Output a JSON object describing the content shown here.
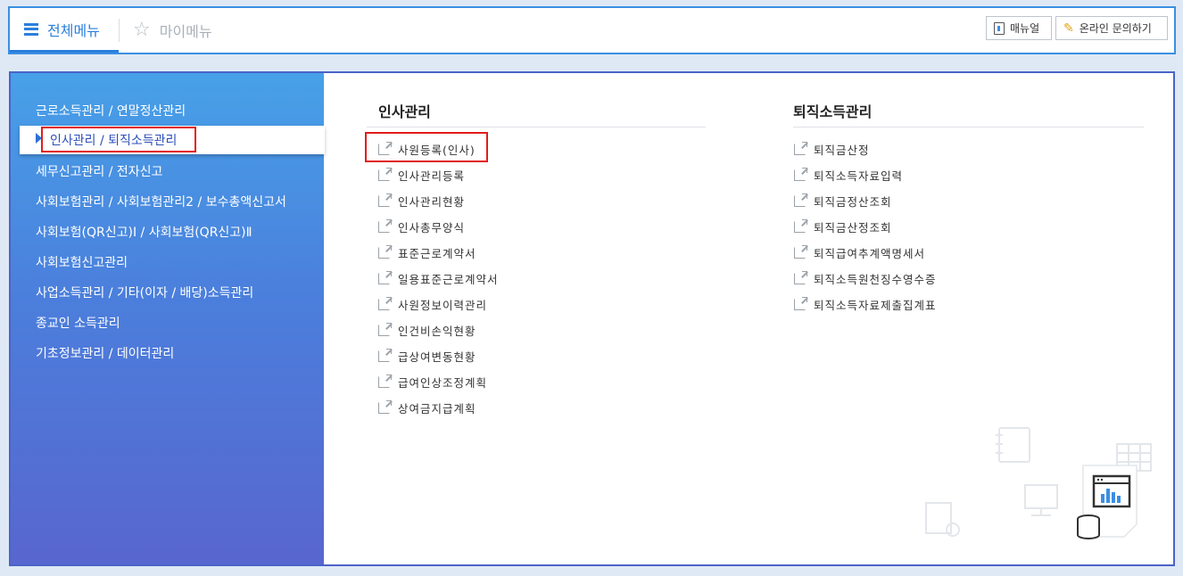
{
  "header": {
    "tab_all": "전체메뉴",
    "tab_my": "마이메뉴",
    "manual_button": "매뉴얼",
    "online_inquiry_button": "온라인 문의하기"
  },
  "sidebar": {
    "items": [
      "근로소득관리 / 연말정산관리",
      "인사관리 / 퇴직소득관리",
      "세무신고관리 / 전자신고",
      "사회보험관리 / 사회보험관리2 / 보수총액신고서",
      "사회보험(QR신고)Ⅰ / 사회보험(QR신고)Ⅱ",
      "사회보험신고관리",
      "사업소득관리 / 기타(이자 / 배당)소득관리",
      "종교인 소득관리",
      "기초정보관리 / 데이터관리"
    ],
    "active_index": 1
  },
  "sections": {
    "hr": {
      "title": "인사관리",
      "links": [
        "사원등록(인사)",
        "인사관리등록",
        "인사관리현황",
        "인사총무양식",
        "표준근로계약서",
        "일용표준근로계약서",
        "사원정보이력관리",
        "인건비손익현황",
        "급상여변동현황",
        "급여인상조정계획",
        "상여금지급계획"
      ]
    },
    "retirement": {
      "title": "퇴직소득관리",
      "links": [
        "퇴직금산정",
        "퇴직소득자료입력",
        "퇴직금정산조회",
        "퇴직금산정조회",
        "퇴직급여추계액명세서",
        "퇴직소득원천징수영수증",
        "퇴직소득자료제출집계표"
      ]
    }
  },
  "colors": {
    "accent": "#2a7fdc",
    "highlight": "#e21c1c",
    "sidebar_top": "#47a1e8",
    "sidebar_bottom": "#5866cf"
  }
}
